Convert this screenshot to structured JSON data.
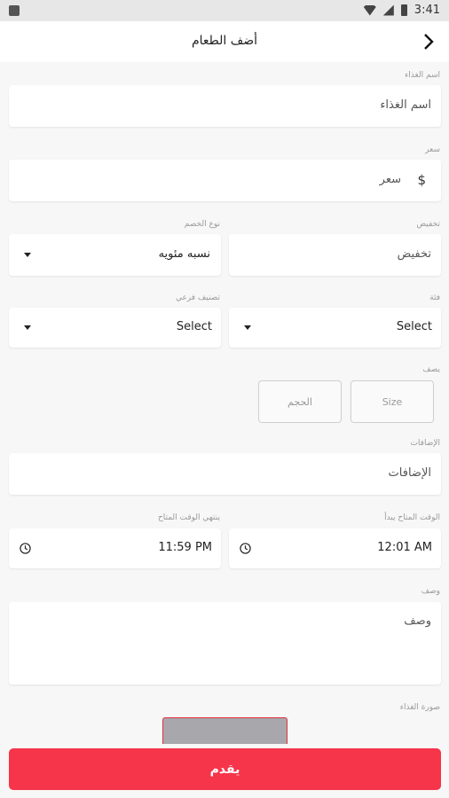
{
  "status_bar": {
    "time": "3:41"
  },
  "app_bar": {
    "title": "أضف الطعام"
  },
  "form": {
    "food_name": {
      "label": "اسم الغذاء",
      "placeholder": "اسم الغذاء"
    },
    "price": {
      "label": "سعر",
      "placeholder": "سعر",
      "currency": "$"
    },
    "discount": {
      "label": "تخفيض",
      "placeholder": "تخفيض"
    },
    "discount_type": {
      "label": "نوع الخصم",
      "value": "نسبه مئويه"
    },
    "category": {
      "label": "فئة",
      "value": "Select"
    },
    "subcategory": {
      "label": "تصنيف فرعي",
      "value": "Select"
    },
    "sizes": {
      "label": "يصف",
      "size_placeholder": "Size",
      "volume_placeholder": "الحجم"
    },
    "additions": {
      "label": "الإضافات",
      "placeholder": "الإضافات"
    },
    "start_time": {
      "label": "الوقت المتاح يبدأ",
      "value": "12:01 AM"
    },
    "end_time": {
      "label": "ينتهي الوقت المتاح",
      "value": "11:59 PM"
    },
    "description": {
      "label": "وصف",
      "placeholder": "وصف"
    },
    "food_image": {
      "label": "صورة الغذاء"
    }
  },
  "submit": {
    "label": "يقدم"
  },
  "colors": {
    "accent": "#f6344a",
    "background": "#f7f7f7"
  }
}
